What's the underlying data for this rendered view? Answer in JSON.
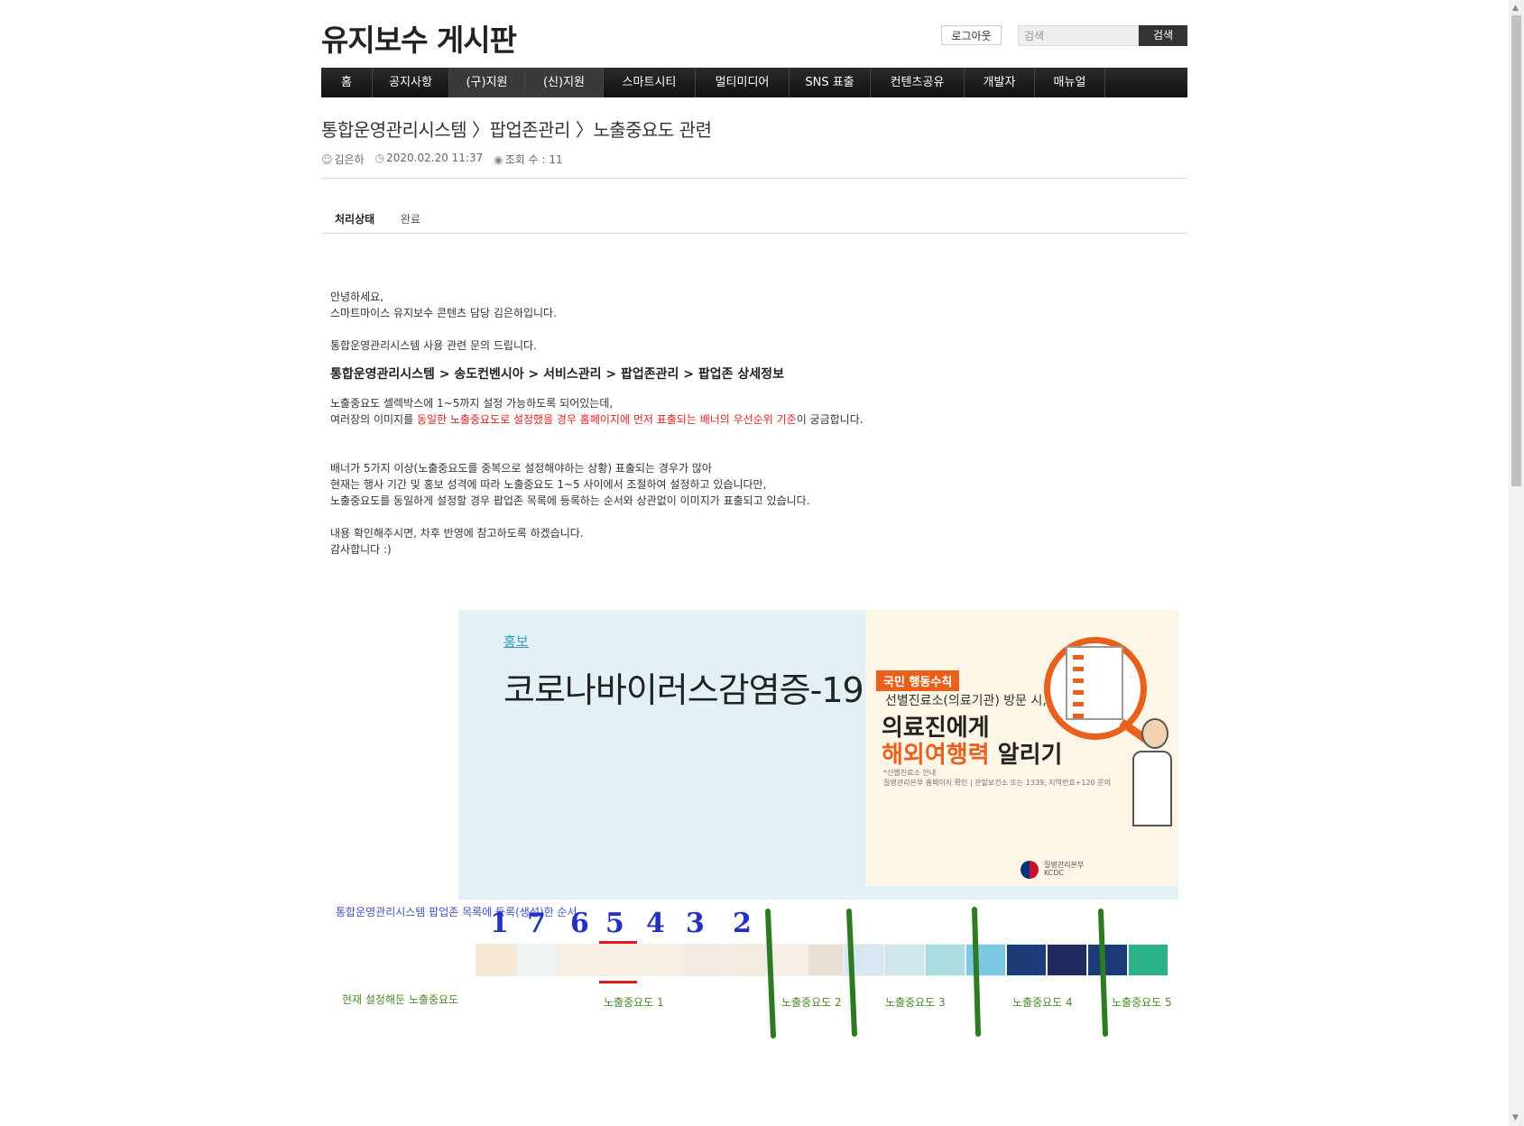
{
  "header": {
    "site_title": "유지보수 게시판",
    "logout_label": "로그아웃",
    "search_placeholder": "검색",
    "search_button": "검색"
  },
  "nav": {
    "items": [
      {
        "label": "홈",
        "width": 56
      },
      {
        "label": "공지사항",
        "width": 84
      },
      {
        "label": "(구)지원",
        "width": 83
      },
      {
        "label": "(신)지원",
        "width": 86
      },
      {
        "label": "스마트시티",
        "width": 101
      },
      {
        "label": "멀티미디어",
        "width": 103
      },
      {
        "label": "SNS 표출",
        "width": 89
      },
      {
        "label": "컨텐츠공유",
        "width": 103
      },
      {
        "label": "개발자",
        "width": 77
      },
      {
        "label": "매뉴얼",
        "width": 77
      }
    ]
  },
  "post": {
    "title": "통합운영관리시스템 〉팝업존관리 〉노출중요도 관련",
    "author": "김은하",
    "datetime": "2020.02.20 11:37",
    "views": "조회 수 : 11",
    "status_label": "처리상태",
    "status_value": "완료",
    "body": {
      "greeting1": "안녕하세요,",
      "greeting2": "스마트마이스 유지보수 콘텐츠 담당 김은하입니다.",
      "intro": "통합운영관리시스템 사용 관련 문의 드립니다.",
      "path": "통합운영관리시스템 > 송도컨벤시아 > 서비스관리 > 팝업존관리 > 팝업존 상세정보",
      "q1": "노출중요도 셀렉박스에 1~5까지 설정 가능하도록 되어있는데,",
      "q2_pre": "여러장의 이미지를 ",
      "q2_red": "동일한 노출중요도로 설정했을 경우 홈페이지에 먼저 표출되는 배너의 우선순위 기준",
      "q2_post": "이 궁금합니다.",
      "d1": "배너가 5가지 이상(노출중요도를 중복으로 설정해야하는 상황) 표출되는 경우가 많아",
      "d2": "현재는 행사 기간 및 홍보 성격에 따라 노출중요도 1~5 사이에서 조절하여 설정하고 있습니다만,",
      "d3": "노출중요도를 동일하게 설정할 경우 팝업존 목록에 등록하는 순서와 상관없이 이미지가 표출되고 있습니다.",
      "c1": "내용 확인해주시면, 차후 반영에 참고하도록 하겠습니다.",
      "c2": "감사합니다 :)"
    }
  },
  "image": {
    "tag": "홍보",
    "headline": "코로나바이러스감염증-19",
    "poster_badge": "국민 행동수칙",
    "poster_line1": "선별진료소(의료기관) 방문 시,",
    "poster_line2": "의료진에게",
    "poster_line3_orange": "해외여행력",
    "poster_line3_rest": " 알리기",
    "poster_small1": "*선별진료소 안내",
    "poster_small2": "질병관리본부 홈페이지 확인 | 관할보건소 또는 1339, 지역번호+120 문의",
    "org_line1": "질병관리본부",
    "org_line2": "KCDC"
  },
  "annotation": {
    "order_label": "통합운영관리시스템 팝업존 목록에 등록(생성)한 순서",
    "order_numbers": [
      "1",
      "7",
      "6",
      "5",
      "4",
      "3",
      "2"
    ],
    "current_label": "현재 설정해둔 노출중요도",
    "levels": [
      "노출중요도 1",
      "노출중요도 2",
      "노출중요도 3",
      "노출중요도 4",
      "노출중요도 5"
    ],
    "thumb_colors": [
      "#f6e6d4",
      "#eef4ef",
      "#f7ede0",
      "#f9eee2",
      "#f6efe3",
      "#f5ece4",
      "#f4ece0",
      "#f6efe6",
      "#e9dfd4",
      "#d8e6f2",
      "#cfe6ec",
      "#a9dde2",
      "#7ec9e2",
      "#1f3c7a",
      "#1e2d5e",
      "#1b3a78",
      "#2bb28a"
    ],
    "divider_color": "#2d7a22"
  }
}
